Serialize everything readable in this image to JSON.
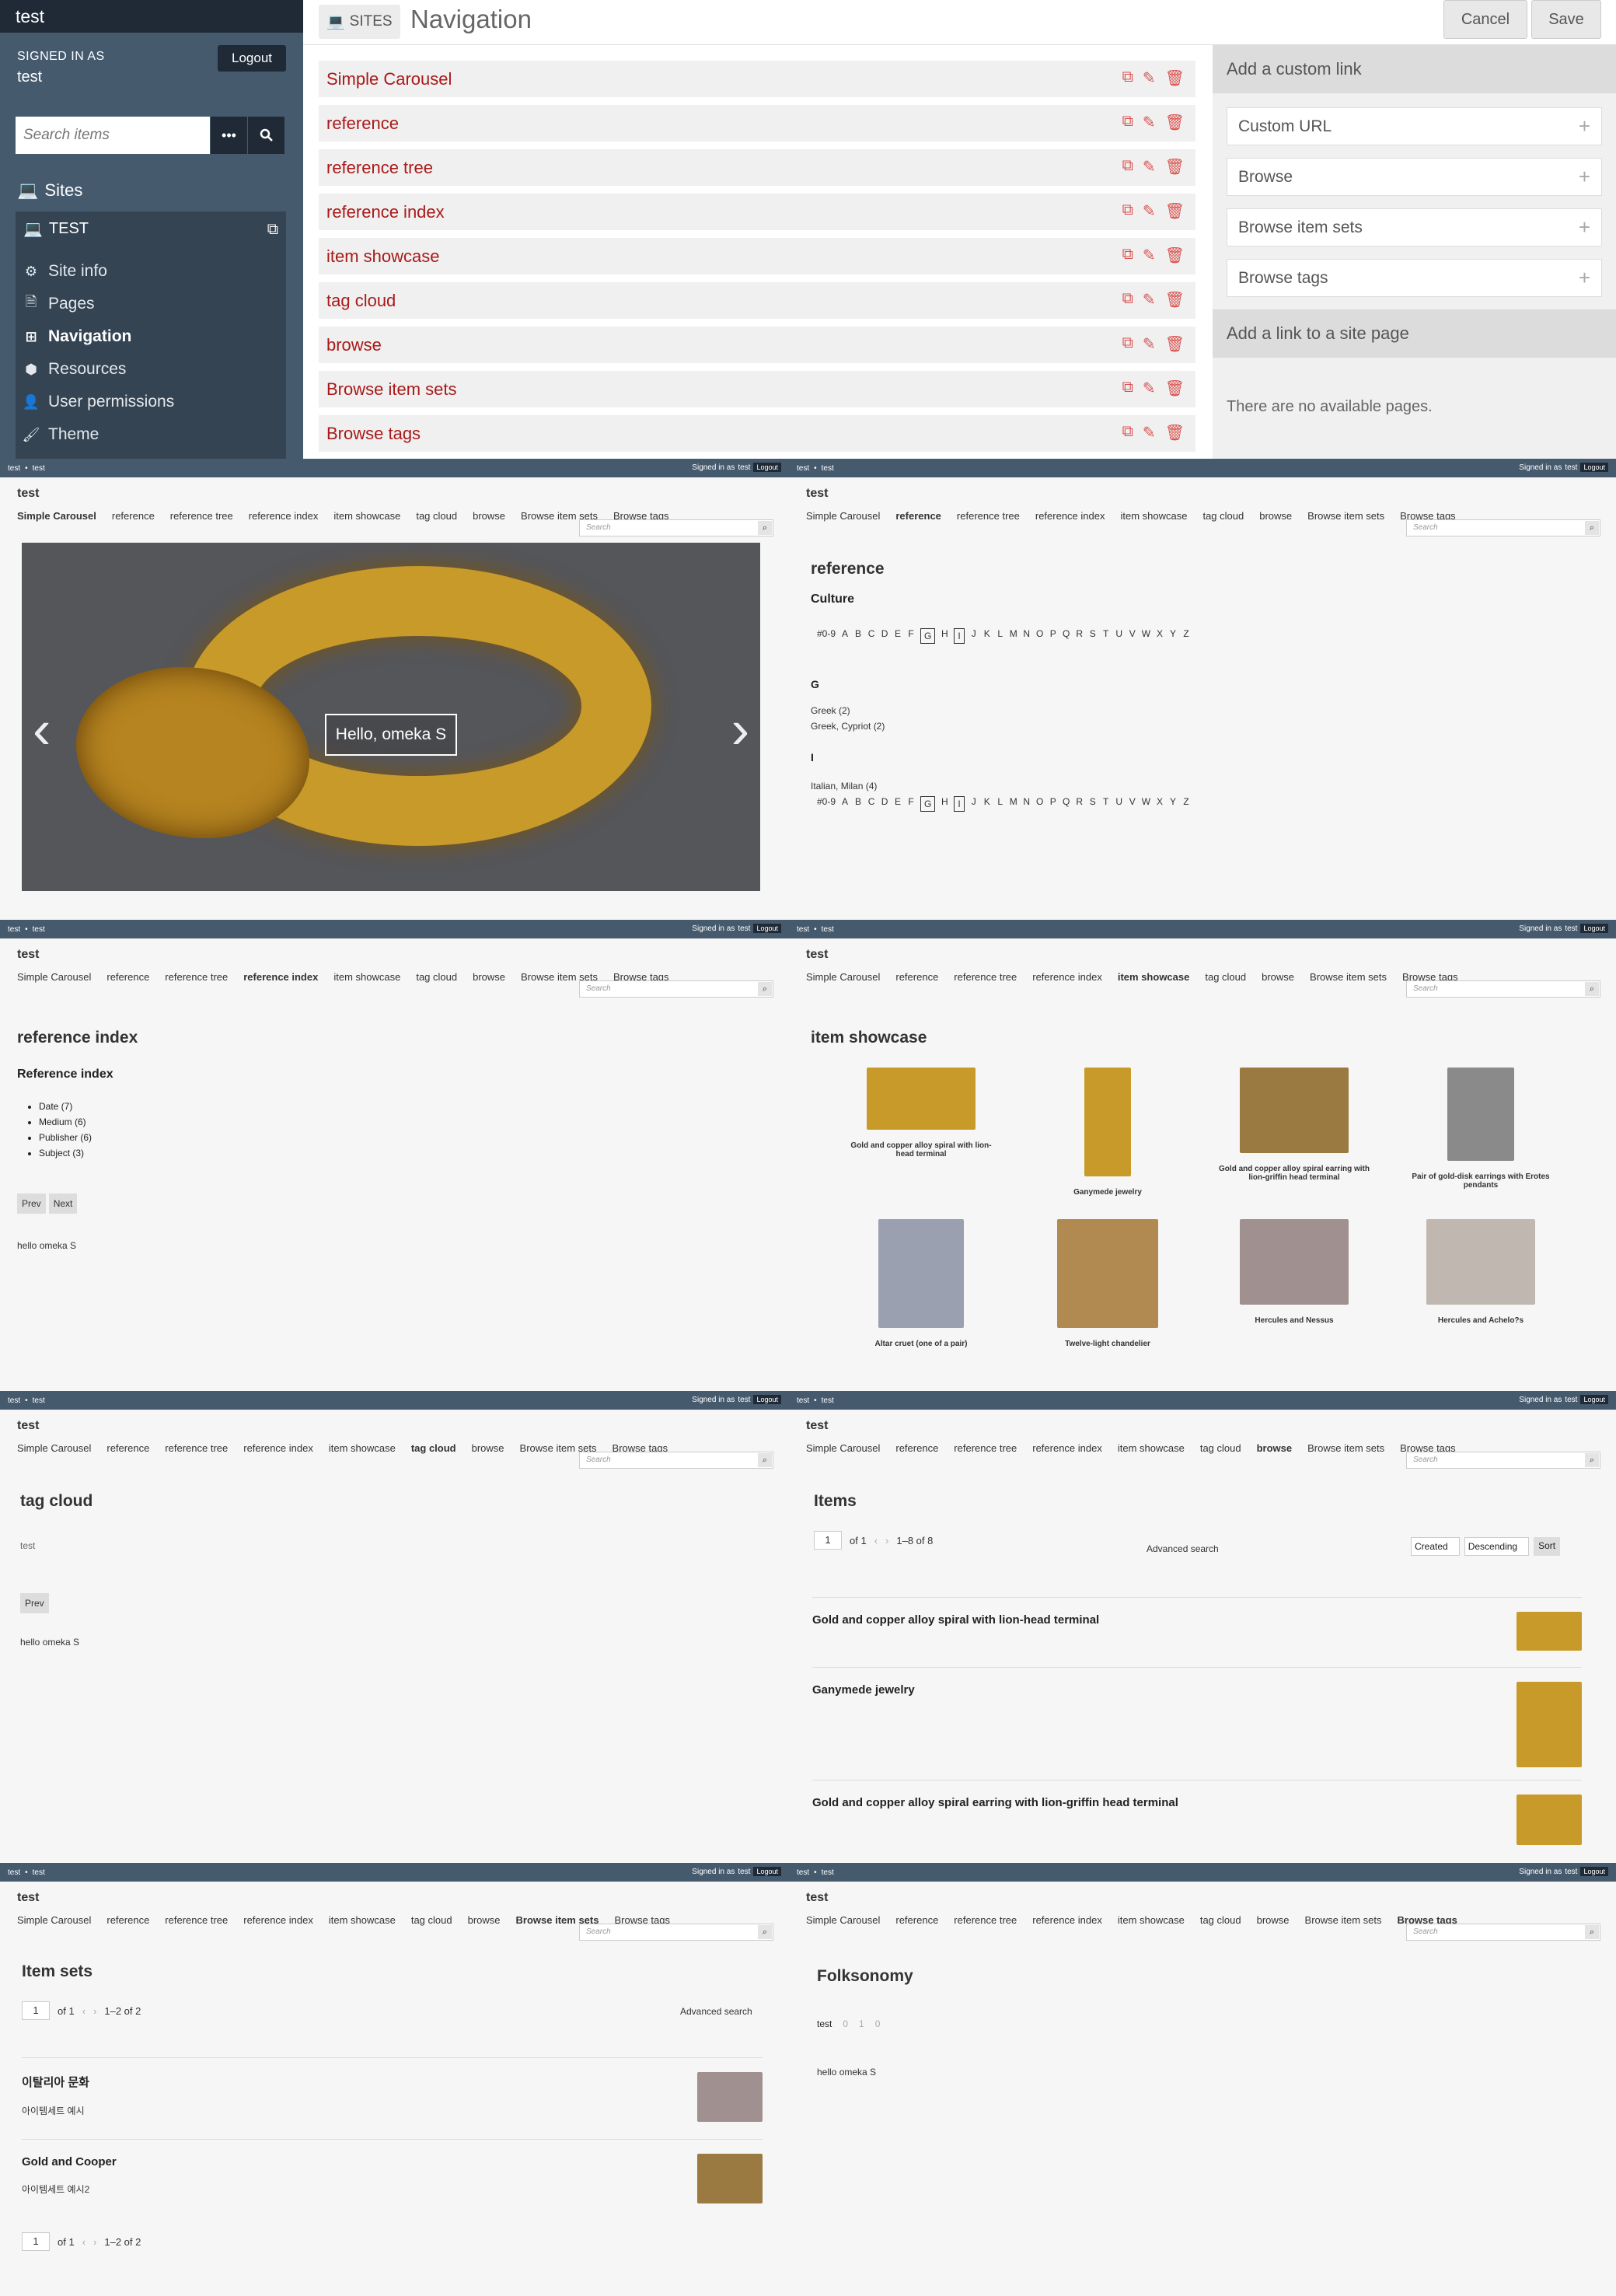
{
  "admin": {
    "app_title": "test",
    "signed_in_label": "SIGNED IN AS",
    "username": "test",
    "logout_label": "Logout",
    "search_placeholder": "Search items",
    "sites_label": "Sites",
    "site_name": "TEST",
    "nav_items": [
      "Site info",
      "Pages",
      "Navigation",
      "Resources",
      "User permissions",
      "Theme"
    ],
    "active_nav": "Navigation",
    "header_section": "SITES",
    "header_title": "Navigation",
    "cancel_label": "Cancel",
    "save_label": "Save",
    "nav_links": [
      "Simple Carousel",
      "reference",
      "reference tree",
      "reference index",
      "item showcase",
      "tag cloud",
      "browse",
      "Browse item sets",
      "Browse tags"
    ],
    "custom_link_heading": "Add a custom link",
    "custom_links": [
      "Custom URL",
      "Browse",
      "Browse item sets",
      "Browse tags"
    ],
    "site_page_heading": "Add a link to a site page",
    "no_pages_text": "There are no available pages.",
    "accent_color": "#a91919"
  },
  "public": {
    "bar_left": "test",
    "bar_mid": "test",
    "signed_in_text": "Signed in as",
    "signed_user": "test",
    "logout": "Logout",
    "site_title": "test",
    "nav": [
      "Simple Carousel",
      "reference",
      "reference tree",
      "reference index",
      "item showcase",
      "tag cloud",
      "browse",
      "Browse item sets",
      "Browse tags"
    ],
    "search_placeholder": "Search"
  },
  "carousel": {
    "caption": "Hello, omeka S"
  },
  "reference": {
    "title": "reference",
    "subtitle": "Culture",
    "letters": [
      "#0-9",
      "A",
      "B",
      "C",
      "D",
      "E",
      "F",
      "G",
      "H",
      "I",
      "J",
      "K",
      "L",
      "M",
      "N",
      "O",
      "P",
      "Q",
      "R",
      "S",
      "T",
      "U",
      "V",
      "W",
      "X",
      "Y",
      "Z"
    ],
    "boxed": [
      "G",
      "I"
    ],
    "group_g": "G",
    "g_items": [
      "Greek (2)",
      "Greek, Cypriot (2)"
    ],
    "group_i": "I",
    "i_items": [
      "Italian, Milan (4)"
    ]
  },
  "reference_index": {
    "title": "reference index",
    "subtitle": "Reference index",
    "items": [
      "Date (7)",
      "Medium (6)",
      "Publisher (6)",
      "Subject (3)"
    ],
    "prev": "Prev",
    "next": "Next",
    "footer": "hello omeka S"
  },
  "showcase": {
    "title": "item showcase",
    "items": [
      "Gold and copper alloy spiral with lion-head terminal",
      "Ganymede jewelry",
      "Gold and copper alloy spiral earring with lion-griffin head terminal",
      "Pair of gold-disk earrings with Erotes pendants",
      "Altar cruet (one of a pair)",
      "Twelve-light chandelier",
      "Hercules and Nessus",
      "Hercules and Achelo?s"
    ]
  },
  "tagcloud": {
    "title": "tag cloud",
    "tag": "test",
    "prev": "Prev",
    "footer": "hello omeka S"
  },
  "browse": {
    "title": "Items",
    "page": "1",
    "of": "of 1",
    "range": "1–8 of 8",
    "advanced": "Advanced search",
    "sort_by": "Created",
    "sort_order": "Descending",
    "sort_btn": "Sort",
    "items": [
      "Gold and copper alloy spiral with lion-head terminal",
      "Ganymede jewelry",
      "Gold and copper alloy spiral earring with lion-griffin head terminal"
    ]
  },
  "itemsets": {
    "title": "Item sets",
    "page": "1",
    "of": "of 1",
    "range": "1–2 of 2",
    "advanced": "Advanced search",
    "sets": [
      {
        "title": "이탈리아 문화",
        "desc": "아이템세트 예시"
      },
      {
        "title": "Gold and Cooper",
        "desc": "아이템세트 예시2"
      }
    ]
  },
  "tags": {
    "title": "Folksonomy",
    "tag": "test",
    "counts": [
      "0",
      "1",
      "0"
    ],
    "footer": "hello omeka S"
  }
}
